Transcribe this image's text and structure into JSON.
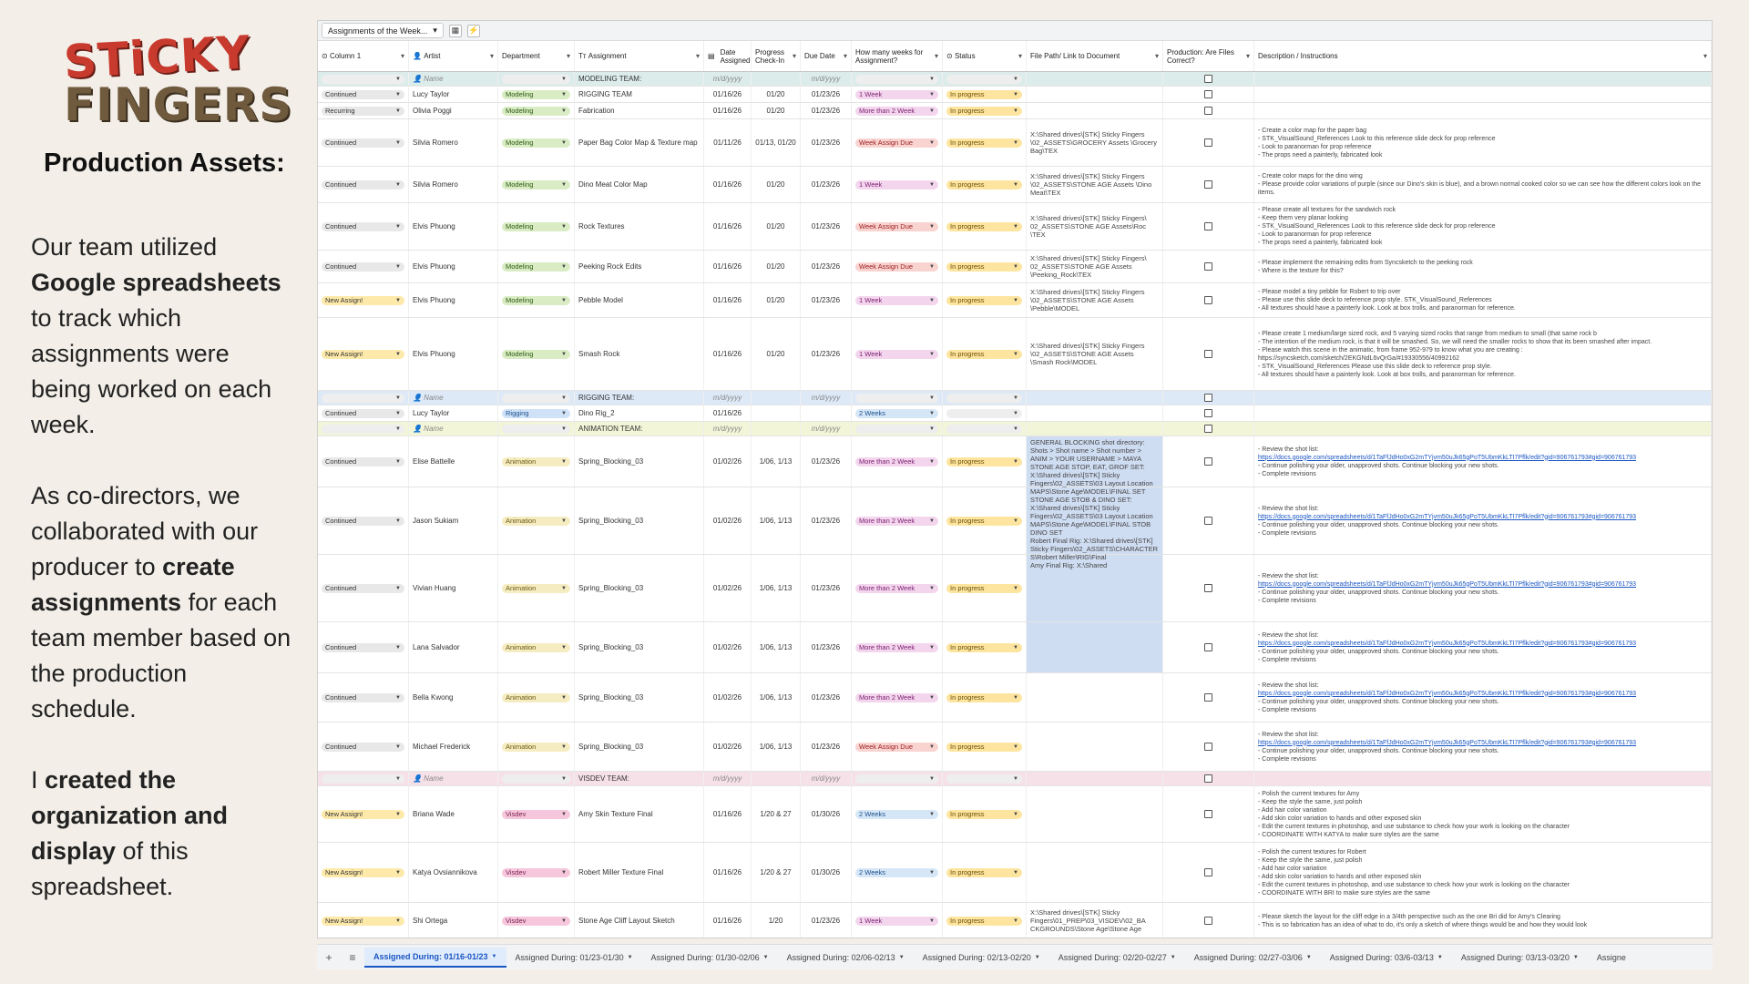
{
  "logo": {
    "line1": "STiCKY",
    "line2": "FINGERS"
  },
  "panel": {
    "title": "Production Assets:",
    "p1_pre": "Our team utilized ",
    "p1_bold": "Google spreadsheets",
    "p1_post": " to track which assignments were being worked on each week.",
    "p2_pre": "As co-directors, we collaborated with our producer to ",
    "p2_bold": "create assignments",
    "p2_post": " for each team member based on the production schedule.",
    "p3_pre": "I ",
    "p3_bold": "created the organization and display",
    "p3_post": " of this spreadsheet."
  },
  "sheet": {
    "view_name": "Assignments of the Week...",
    "headers": {
      "col1": "Column 1",
      "artist": "Artist",
      "dept": "Department",
      "assign": "Assignment",
      "date": "Date Assigned",
      "prog": "Progress Check-In",
      "due": "Due Date",
      "weeks": "How many weeks for Assignment?",
      "status": "Status",
      "file": "File Path/ Link to Document",
      "prod": "Production: Are Files Correct?",
      "desc": "Description / Instructions"
    },
    "placeholders": {
      "name": "Name",
      "date": "m/d/yyyy"
    },
    "teams": {
      "modeling": "MODELING TEAM:",
      "rigging": "RIGGING TEAM:",
      "animation": "ANIMATION TEAM:",
      "visdev": "VISDEV TEAM:"
    },
    "rows_modeling": [
      {
        "col1": "Continued",
        "artist": "Lucy Taylor",
        "dept": "Modeling",
        "assign": "RIGGING TEAM",
        "date": "01/16/26",
        "prog": "01/20",
        "due": "01/23/26",
        "weeks": "1 Week",
        "status": "In progress",
        "file": "",
        "desc": ""
      },
      {
        "col1": "Recurring",
        "artist": "Olivia Poggi",
        "dept": "Modeling",
        "assign": "Fabrication",
        "date": "01/16/26",
        "prog": "01/20",
        "due": "01/23/26",
        "weeks": "More than 2 Week",
        "status": "In progress",
        "file": "",
        "desc": ""
      },
      {
        "col1": "Continued",
        "artist": "Silvia Romero",
        "dept": "Modeling",
        "assign": "Paper Bag Color Map & Texture map",
        "date": "01/11/26",
        "prog": "01/13, 01/20",
        "due": "01/23/26",
        "weeks": "Week Assign Due",
        "status": "In progress",
        "file": "X:\\Shared drives\\[STK] Sticky Fingers \\02_ASSETS\\GROCERY Assets \\Grocery Bag\\TEX",
        "desc": "- Create a color map for the paper bag\n- STK_VisualSound_References  Look to this reference slide deck for prop reference\n- Look to paranorman for prop reference\n- The props need a painterly, fabricated look"
      },
      {
        "col1": "Continued",
        "artist": "Silvia Romero",
        "dept": "Modeling",
        "assign": "Dino Meat Color Map",
        "date": "01/16/26",
        "prog": "01/20",
        "due": "01/23/26",
        "weeks": "1 Week",
        "status": "In progress",
        "file": "X:\\Shared drives\\[STK] Sticky Fingers \\02_ASSETS\\STONE AGE Assets \\Dino Meat\\TEX",
        "desc": "- Create color maps for the dino wing\n- Please provide color variations of purple (since our Dino's skin is blue), and a brown normal cooked color so we can see how the different colors look on the items."
      },
      {
        "col1": "Continued",
        "artist": "Elvis Phuong",
        "dept": "Modeling",
        "assign": "Rock Textures",
        "date": "01/16/26",
        "prog": "01/20",
        "due": "01/23/26",
        "weeks": "Week Assign Due",
        "status": "In progress",
        "file": "X:\\Shared drives\\[STK] Sticky Fingers\\ 02_ASSETS\\STONE AGE Assets\\Roc \\TEX",
        "desc": "- Please create all textures for the sandwich rock\n- Keep them very planar looking\n- STK_VisualSound_References  Look to this reference slide deck for prop reference\n- Look to paranorman for prop reference\n- The props need a painterly, fabricated look"
      },
      {
        "col1": "Continued",
        "artist": "Elvis Phuong",
        "dept": "Modeling",
        "assign": "Peeking Rock Edits",
        "date": "01/16/26",
        "prog": "01/20",
        "due": "01/23/26",
        "weeks": "Week Assign Due",
        "status": "In progress",
        "file": "X:\\Shared drives\\[STK] Sticky Fingers\\ 02_ASSETS\\STONE AGE Assets \\Peeking_Rock\\TEX",
        "desc": "- Please implement the remaining edits from Syncsketch to the peeking rock\n- Where is the texture for this?"
      },
      {
        "col1": "New Assign!",
        "artist": "Elvis Phuong",
        "dept": "Modeling",
        "assign": "Pebble Model",
        "date": "01/16/26",
        "prog": "01/20",
        "due": "01/23/26",
        "weeks": "1 Week",
        "status": "In progress",
        "file": "X:\\Shared drives\\[STK] Sticky Fingers \\02_ASSETS\\STONE AGE Assets \\Pebble\\MODEL",
        "desc": "- Please model a tiny pebble for Robert to trip over\n- Please use this slide deck to reference prop style.  STK_VisualSound_References\n- All textures should have a painterly look. Look at box trolls, and paranorman for reference."
      },
      {
        "col1": "New Assign!",
        "artist": "Elvis Phuong",
        "dept": "Modeling",
        "assign": "Smash Rock",
        "date": "01/16/26",
        "prog": "01/20",
        "due": "01/23/26",
        "weeks": "1 Week",
        "status": "In progress",
        "file": "X:\\Shared drives\\[STK] Sticky Fingers \\02_ASSETS\\STONE AGE Assets \\Smash Rock\\MODEL",
        "desc": "- Please create 1 medium/large sized rock, and 5 varying sized rocks that range from medium to small (that same rock b\n- The intention of the medium rock, is that it will be smashed. So, we will need the smaller rocks to show that its been smashed after impact.\n- Please watch this scene in the animatic, from frame 952-979 to know what you are creating : https://syncsketch.com/sketch/2EKGNdL6vQrGa/#19330556/40992162\n- STK_VisualSound_References  Please use this slide deck to reference prop style.\n- All textures should have a painterly look. Look at box trolls, and paranorman for reference."
      }
    ],
    "rows_rigging": [
      {
        "col1": "Continued",
        "artist": "Lucy Taylor",
        "dept": "Rigging",
        "assign": "Dino Rig_2",
        "date": "01/16/26",
        "prog": "",
        "due": "",
        "weeks": "2 Weeks",
        "status": "",
        "file": "",
        "desc": ""
      }
    ],
    "rows_animation": [
      {
        "col1": "Continued",
        "artist": "Elise Battelle",
        "dept": "Animation",
        "assign": "Spring_Blocking_03",
        "date": "01/02/26",
        "prog": "1/06, 1/13",
        "due": "01/23/26",
        "weeks": "More than 2 Week",
        "status": "In progress",
        "desc": "- Review the shot list:\nhttps://docs.google.com/spreadsheets/d/1TaFfJdHo0xG2mTYjvm50uJk65gPoT5UbmKkLTI7Pflk/edit?gid=906761793#gid=906761793\n- Continue polishing your older, unapproved shots. Continue blocking your new shots.\n- Complete revisions"
      },
      {
        "col1": "Continued",
        "artist": "Jason Sukiam",
        "dept": "Animation",
        "assign": "Spring_Blocking_03",
        "date": "01/02/26",
        "prog": "1/06, 1/13",
        "due": "01/23/26",
        "weeks": "More than 2 Week",
        "status": "In progress",
        "desc": "- Review the shot list:\nhttps://docs.google.com/spreadsheets/d/1TaFfJdHo0xG2mTYjvm50uJk65gPoT5UbmKkLTI7Pflk/edit?gid=906761793#gid=906761793\n- Continue polishing your older, unapproved shots. Continue blocking your new shots.\n- Complete revisions"
      },
      {
        "col1": "Continued",
        "artist": "Vivian Huang",
        "dept": "Animation",
        "assign": "Spring_Blocking_03",
        "date": "01/02/26",
        "prog": "1/06, 1/13",
        "due": "01/23/26",
        "weeks": "More than 2 Week",
        "status": "In progress",
        "desc": "- Review the shot list:\nhttps://docs.google.com/spreadsheets/d/1TaFfJdHo0xG2mTYjvm50uJk65gPoT5UbmKkLTI7Pflk/edit?gid=906761793#gid=906761793\n- Continue polishing your older, unapproved shots. Continue blocking your new shots.\n- Complete revisions"
      },
      {
        "col1": "Continued",
        "artist": "Lana Salvador",
        "dept": "Animation",
        "assign": "Spring_Blocking_03",
        "date": "01/02/26",
        "prog": "1/06, 1/13",
        "due": "01/23/26",
        "weeks": "More than 2 Week",
        "status": "In progress",
        "desc": "- Review the shot list:\nhttps://docs.google.com/spreadsheets/d/1TaFfJdHo0xG2mTYjvm50uJk65gPoT5UbmKkLTI7Pflk/edit?gid=906761793#gid=906761793\n- Continue polishing your older, unapproved shots. Continue blocking your new shots.\n- Complete revisions"
      },
      {
        "col1": "Continued",
        "artist": "Bella Kwong",
        "dept": "Animation",
        "assign": "Spring_Blocking_03",
        "date": "01/02/26",
        "prog": "1/06, 1/13",
        "due": "01/23/26",
        "weeks": "More than 2 Week",
        "status": "In progress",
        "desc": "- Review the shot list:\nhttps://docs.google.com/spreadsheets/d/1TaFfJdHo0xG2mTYjvm50uJk65gPoT5UbmKkLTI7Pflk/edit?gid=906761793#gid=906761793\n- Continue polishing your older, unapproved shots. Continue blocking your new shots.\n- Complete revisions"
      },
      {
        "col1": "Continued",
        "artist": "Michael Frederick",
        "dept": "Animation",
        "assign": "Spring_Blocking_03",
        "date": "01/02/26",
        "prog": "1/06, 1/13",
        "due": "01/23/26",
        "weeks": "Week Assign Due",
        "status": "In progress",
        "desc": "- Review the shot list:\nhttps://docs.google.com/spreadsheets/d/1TaFfJdHo0xG2mTYjvm50uJk65gPoT5UbmKkLTI7Pflk/edit?gid=906761793#gid=906761793\n- Continue polishing your older, unapproved shots. Continue blocking your new shots.\n- Complete revisions"
      }
    ],
    "layout_file_text": "GENERAL BLOCKING shot directory: Shots > Shot name > Shot number > ANIM > YOUR USERNAME > MAYA\n\nSTONE AGE STOP, EAT, GROF SET:\n\nX:\\Shared drives\\[STK] Sticky Fingers\\02_ASSETS\\03 Layout Location MAPS\\Stone Age\\MODEL\\FINAL SET\n\nSTONE AGE STOB & DINO SET:\n\nX:\\Shared drives\\[STK] Sticky Fingers\\02_ASSETS\\03 Layout Location MAPS\\Stone Age\\MODEL\\FINAL STOB DINO SET\n\nRobert Final Rig: X:\\Shared drives\\[STK] Sticky Fingers\\02_ASSETS\\CHARACTER S\\Robert Miller\\RIG\\Final\nAmy Final Rig: X:\\Shared",
    "rows_visdev": [
      {
        "col1": "New Assign!",
        "artist": "Briana Wade",
        "dept": "Visdev",
        "assign": "Amy Skin Texture Final",
        "date": "01/16/26",
        "prog": "1/20 & 27",
        "due": "01/30/26",
        "weeks": "2 Weeks",
        "status": "In progress",
        "file": "",
        "desc": "- Polish the current textures for Amy\n- Keep the style the same, just polish\n- Add hair color variation\n- Add skin color variation to hands and other exposed skin\n- Edit the current textures in photoshop, and use substance to check how your work is looking on the character\n- COORDINATE WITH KATYA to make sure styles are the same"
      },
      {
        "col1": "New Assign!",
        "artist": "Katya Ovsiannikova",
        "dept": "Visdev",
        "assign": "Robert Miller Texture Final",
        "date": "01/16/26",
        "prog": "1/20 & 27",
        "due": "01/30/26",
        "weeks": "2 Weeks",
        "status": "In progress",
        "file": "",
        "desc": "- Polish the current textures for Robert\n- Keep the style the same, just polish\n- Add hair color variation\n- Add skin color variation to hands and other exposed skin\n- Edit the current textures in photoshop, and use substance to check how your work is looking on the character\n- COORDINATE WITH BRI to make sure styles are the same"
      },
      {
        "col1": "New Assign!",
        "artist": "Shi Ortega",
        "dept": "Visdev",
        "assign": "Stone Age Cliff Layout Sketch",
        "date": "01/16/26",
        "prog": "1/20",
        "due": "01/23/26",
        "weeks": "1 Week",
        "status": "In progress",
        "file": "X:\\Shared drives\\[STK] Sticky Fingers\\01_PREP\\03_VISDEV\\02_BA CKGROUNDS\\Stone Age\\Stone Age",
        "desc": "- Please sketch the layout for the cliff edge in a 3/4th perspective such as the one Bri did for Amy's Clearing\n- This is so fabrication has an idea of what to do, it's only a sketch of where things would be and how they would look"
      }
    ]
  },
  "tabs": [
    "Assigned During: 01/16-01/23",
    "Assigned During: 01/23-01/30",
    "Assigned During: 01/30-02/06",
    "Assigned During: 02/06-02/13",
    "Assigned During: 02/13-02/20",
    "Assigned During: 02/20-02/27",
    "Assigned During: 02/27-03/06",
    "Assigned During: 03/6-03/13",
    "Assigned During: 03/13-03/20",
    "Assigne"
  ],
  "colors": {
    "accent": "#1a56c4",
    "logo_red": "#c93a2e",
    "logo_brown": "#6f5a3e",
    "background": "#f3efe8"
  }
}
